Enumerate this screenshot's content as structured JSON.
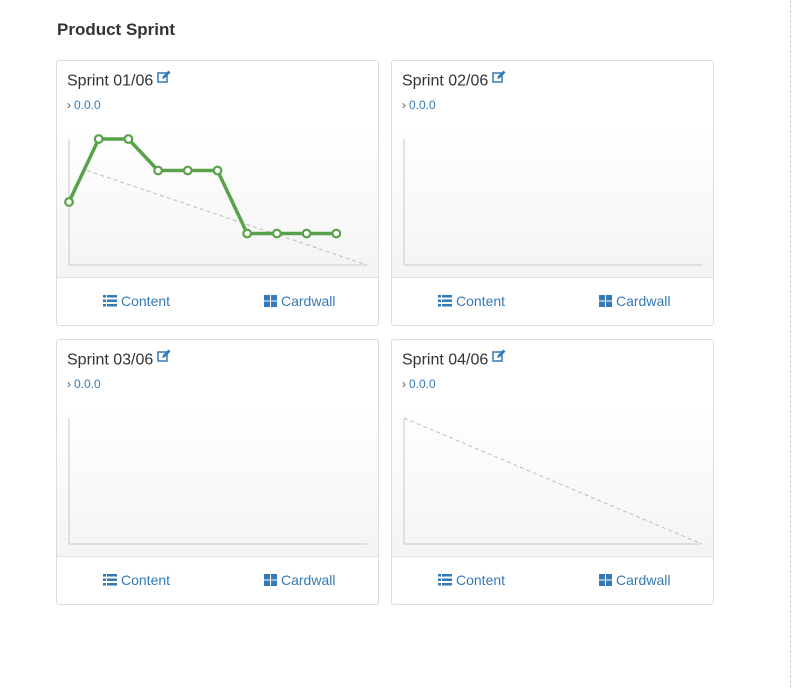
{
  "page": {
    "title": "Product Sprint"
  },
  "sprints": [
    {
      "name": "Sprint 01/06",
      "version": "0.0.0",
      "content_label": "Content",
      "cardwall_label": "Cardwall"
    },
    {
      "name": "Sprint 02/06",
      "version": "0.0.0",
      "content_label": "Content",
      "cardwall_label": "Cardwall"
    },
    {
      "name": "Sprint 03/06",
      "version": "0.0.0",
      "content_label": "Content",
      "cardwall_label": "Cardwall"
    },
    {
      "name": "Sprint 04/06",
      "version": "0.0.0",
      "content_label": "Content",
      "cardwall_label": "Cardwall"
    }
  ],
  "colors": {
    "burndown_line": "#5aa24a",
    "ideal_line": "#bdbdbd",
    "link": "#337ab7"
  },
  "icons": {
    "edit": "edit-icon",
    "content": "list-icon",
    "cardwall": "grid-icon",
    "version_prefix": "chevron-right-icon"
  },
  "chart_data": [
    {
      "type": "line",
      "series": [
        {
          "values": [
            2,
            4,
            4,
            3,
            3,
            3,
            1,
            1,
            1,
            1
          ]
        }
      ],
      "ideal": {
        "from": 3,
        "to": 0
      },
      "ylim": [
        0,
        4
      ]
    },
    {
      "type": "line",
      "series": []
    },
    {
      "type": "line",
      "series": []
    },
    {
      "type": "line",
      "series": [],
      "ideal": {
        "from": 3,
        "to": 0
      },
      "ylim": [
        0,
        3
      ]
    }
  ]
}
